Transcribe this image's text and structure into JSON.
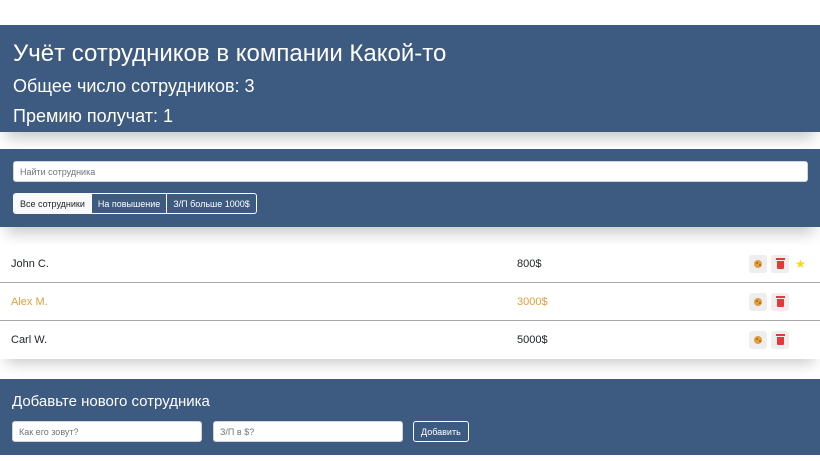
{
  "header": {
    "title": "Учёт сотрудников в компании Какой-то",
    "total_label": "Общее число сотрудников: 3",
    "bonus_label": "Премию получат: 1"
  },
  "search": {
    "placeholder": "Найти сотрудника",
    "filters": [
      {
        "label": "Все сотрудники",
        "active": true
      },
      {
        "label": "На повышение",
        "active": false
      },
      {
        "label": "З/П больше 1000$",
        "active": false
      }
    ]
  },
  "employees": [
    {
      "name": "John C.",
      "salary": "800$",
      "increase": false,
      "star": true
    },
    {
      "name": "Alex M.",
      "salary": "3000$",
      "increase": true,
      "star": false
    },
    {
      "name": "Carl W.",
      "salary": "5000$",
      "increase": false,
      "star": false
    }
  ],
  "icons": {
    "increase": "cookie-icon",
    "delete": "trash-icon",
    "star": "star-icon"
  },
  "colors": {
    "panel": "#3d5a80",
    "increase_text": "#e09f3e",
    "delete": "#e5383b",
    "star": "#ffd60a"
  },
  "add_form": {
    "title": "Добавьте нового сотрудника",
    "name_placeholder": "Как его зовут?",
    "salary_placeholder": "З/П в $?",
    "submit_label": "Добавить"
  }
}
